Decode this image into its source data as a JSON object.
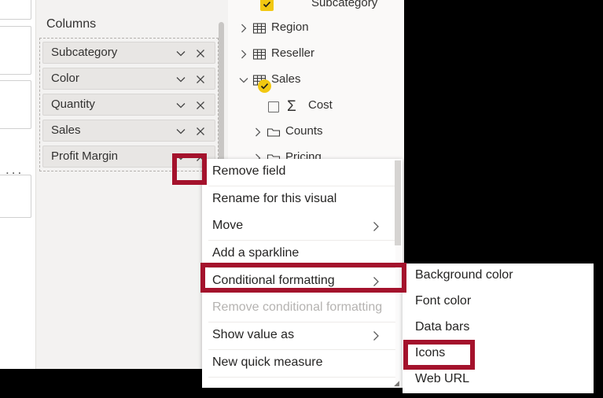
{
  "build_pane": {
    "section_label": "Columns",
    "fields": [
      {
        "label": "Subcategory",
        "caret": "chevron-down-icon",
        "remove": "close-icon"
      },
      {
        "label": "Color",
        "caret": "chevron-down-icon",
        "remove": "close-icon"
      },
      {
        "label": "Quantity",
        "caret": "chevron-down-icon",
        "remove": "close-icon"
      },
      {
        "label": "Sales",
        "caret": "chevron-down-icon",
        "remove": "close-icon"
      },
      {
        "label": "Profit Margin",
        "caret": "chevron-down-icon",
        "remove": "close-icon"
      }
    ]
  },
  "fields_tree": {
    "items": [
      {
        "label": "Subcategory",
        "type": "field",
        "indent": 2,
        "state": "checked"
      },
      {
        "label": "Region",
        "type": "table",
        "indent": 0,
        "expanded": false
      },
      {
        "label": "Reseller",
        "type": "table",
        "indent": 0,
        "expanded": false
      },
      {
        "label": "Sales",
        "type": "table",
        "indent": 0,
        "expanded": true,
        "state": "checked"
      },
      {
        "label": "Cost",
        "type": "measure",
        "indent": 2,
        "state": "unchecked"
      },
      {
        "label": "Counts",
        "type": "folder",
        "indent": 1,
        "expanded": false
      },
      {
        "label": "Pricing",
        "type": "folder",
        "indent": 1,
        "expanded": false
      }
    ]
  },
  "context_menu": {
    "items": [
      {
        "label": "Remove field",
        "submenu": false,
        "disabled": false
      },
      {
        "label": "Rename for this visual",
        "submenu": false,
        "disabled": false
      },
      {
        "label": "Move",
        "submenu": true,
        "disabled": false
      },
      {
        "label": "Add a sparkline",
        "submenu": false,
        "disabled": false
      },
      {
        "label": "Conditional formatting",
        "submenu": true,
        "disabled": false
      },
      {
        "label": "Remove conditional formatting",
        "submenu": false,
        "disabled": true
      },
      {
        "label": "Show value as",
        "submenu": true,
        "disabled": false
      },
      {
        "label": "New quick measure",
        "submenu": false,
        "disabled": false
      }
    ]
  },
  "submenu": {
    "items": [
      {
        "label": "Background color"
      },
      {
        "label": "Font color"
      },
      {
        "label": "Data bars"
      },
      {
        "label": "Icons"
      },
      {
        "label": "Web URL"
      }
    ]
  },
  "annotations": {
    "highlight_color": "#a4122c",
    "boxes": [
      {
        "target": "profit-margin-caret"
      },
      {
        "target": "conditional-formatting-item"
      },
      {
        "target": "icons-submenu-item"
      }
    ]
  },
  "canvas": {
    "overflow_menu": "..."
  }
}
